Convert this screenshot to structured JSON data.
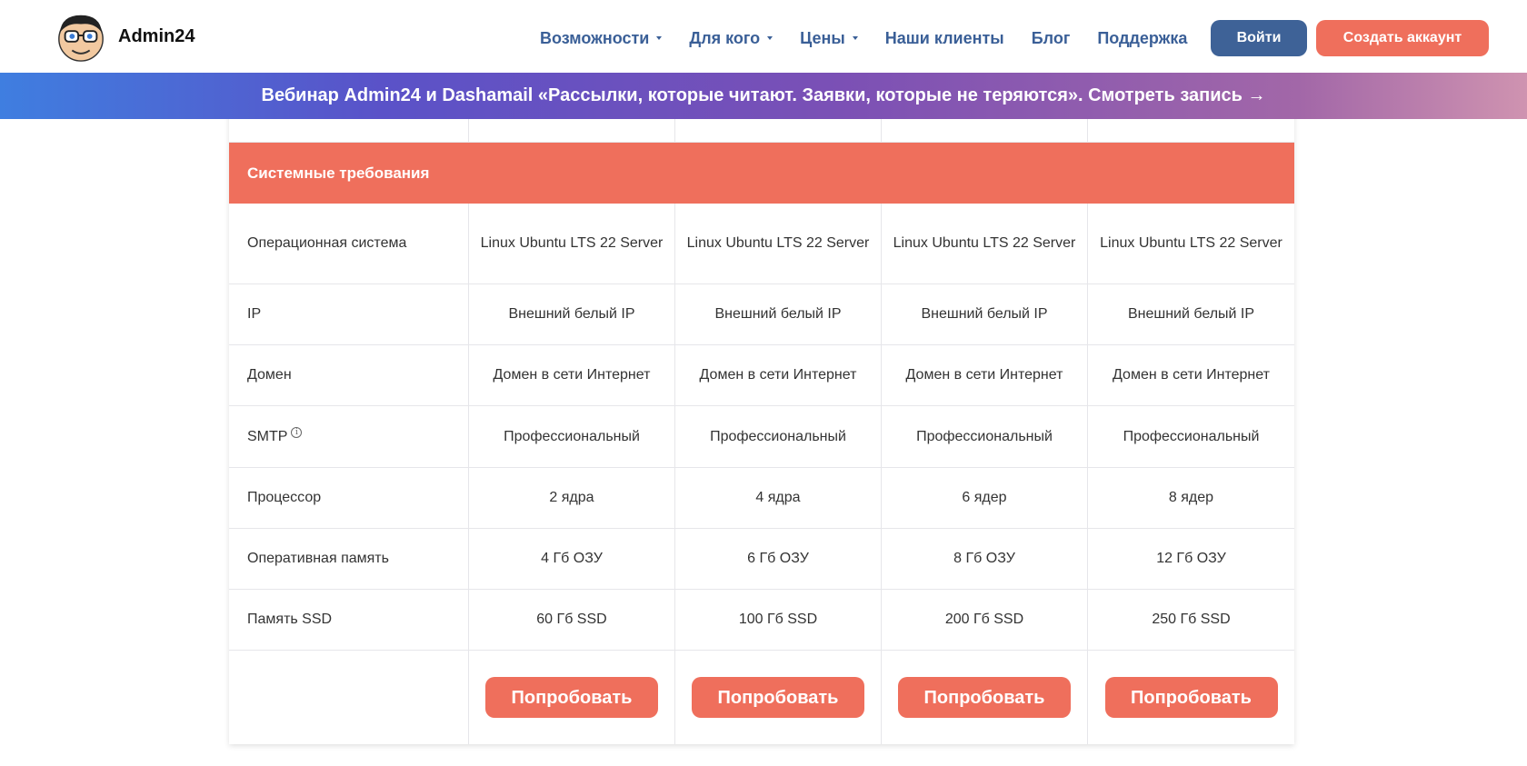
{
  "header": {
    "logo_text": "Admin24",
    "nav": [
      {
        "label": "Возможности",
        "has_dropdown": true
      },
      {
        "label": "Для кого",
        "has_dropdown": true
      },
      {
        "label": "Цены",
        "has_dropdown": true
      },
      {
        "label": "Наши клиенты",
        "has_dropdown": false
      },
      {
        "label": "Блог",
        "has_dropdown": false
      },
      {
        "label": "Поддержка",
        "has_dropdown": false
      }
    ],
    "login_label": "Войти",
    "signup_label": "Создать аккаунт"
  },
  "banner": {
    "text": "Вебинар Admin24 и Dashamail «Рассылки, которые читают. Заявки, которые не теряются». Смотреть запись →"
  },
  "table": {
    "section_title": "Системные требования",
    "rows": [
      {
        "label": "Операционная система",
        "values": [
          "Linux Ubuntu LTS 22 Server",
          "Linux Ubuntu LTS 22 Server",
          "Linux Ubuntu LTS 22 Server",
          "Linux Ubuntu LTS 22 Server"
        ]
      },
      {
        "label": "IP",
        "values": [
          "Внешний белый IP",
          "Внешний белый IP",
          "Внешний белый IP",
          "Внешний белый IP"
        ]
      },
      {
        "label": "Домен",
        "values": [
          "Домен в сети Интернет",
          "Домен в сети Интернет",
          "Домен в сети Интернет",
          "Домен в сети Интернет"
        ]
      },
      {
        "label": "SMTP",
        "values": [
          "Профессиональный",
          "Профессиональный",
          "Профессиональный",
          "Профессиональный"
        ]
      },
      {
        "label": "Процессор",
        "values": [
          "2 ядра",
          "4 ядра",
          "6 ядер",
          "8 ядер"
        ]
      },
      {
        "label": "Оперативная память",
        "values": [
          "4 Гб ОЗУ",
          "6 Гб ОЗУ",
          "8 Гб ОЗУ",
          "12 Гб ОЗУ"
        ]
      },
      {
        "label": "Память SSD",
        "values": [
          "60 Гб SSD",
          "100 Гб SSD",
          "200 Гб SSD",
          "250 Гб SSD"
        ]
      }
    ],
    "try_label": "Попробовать"
  },
  "colors": {
    "accent": "#ef6f5c",
    "primary": "#3e6297",
    "nav_text": "#3a5f97"
  },
  "icons": {
    "smtp_info": "info-icon"
  }
}
